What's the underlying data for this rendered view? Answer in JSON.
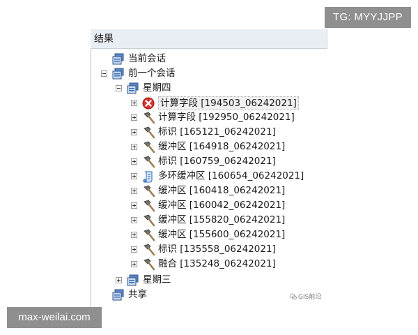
{
  "overlays": {
    "top_right_text": "TG: MYYJJPP",
    "bottom_left_text": "max-weilai.com",
    "watermark_text": "GIS前沿"
  },
  "panel": {
    "title": "结果"
  },
  "tree": {
    "current_session": "当前会话",
    "previous_session": "前一个会话",
    "thursday": "星期四",
    "thursday_items": [
      {
        "label": "计算字段 [194503_06242021]",
        "icon": "error-icon",
        "selected": true
      },
      {
        "label": "计算字段 [192950_06242021]",
        "icon": "hammer-icon"
      },
      {
        "label": "标识 [165121_06242021]",
        "icon": "hammer-icon"
      },
      {
        "label": "缓冲区 [164918_06242021]",
        "icon": "hammer-icon"
      },
      {
        "label": "标识 [160759_06242021]",
        "icon": "hammer-icon"
      },
      {
        "label": "多环缓冲区 [160654_06242021]",
        "icon": "script-icon"
      },
      {
        "label": "缓冲区 [160418_06242021]",
        "icon": "hammer-icon"
      },
      {
        "label": "缓冲区 [160042_06242021]",
        "icon": "hammer-icon"
      },
      {
        "label": "缓冲区 [155820_06242021]",
        "icon": "hammer-icon"
      },
      {
        "label": "缓冲区 [155600_06242021]",
        "icon": "hammer-icon"
      },
      {
        "label": "标识 [135558_06242021]",
        "icon": "hammer-icon"
      },
      {
        "label": "融合 [135248_06242021]",
        "icon": "hammer-icon"
      }
    ],
    "wednesday": "星期三",
    "shared": "共享"
  },
  "colors": {
    "error_red": "#d8322e",
    "hammer_head": "#6f6f6f",
    "hammer_handle": "#9a7b54",
    "session_blue": "#3b6fb0"
  }
}
